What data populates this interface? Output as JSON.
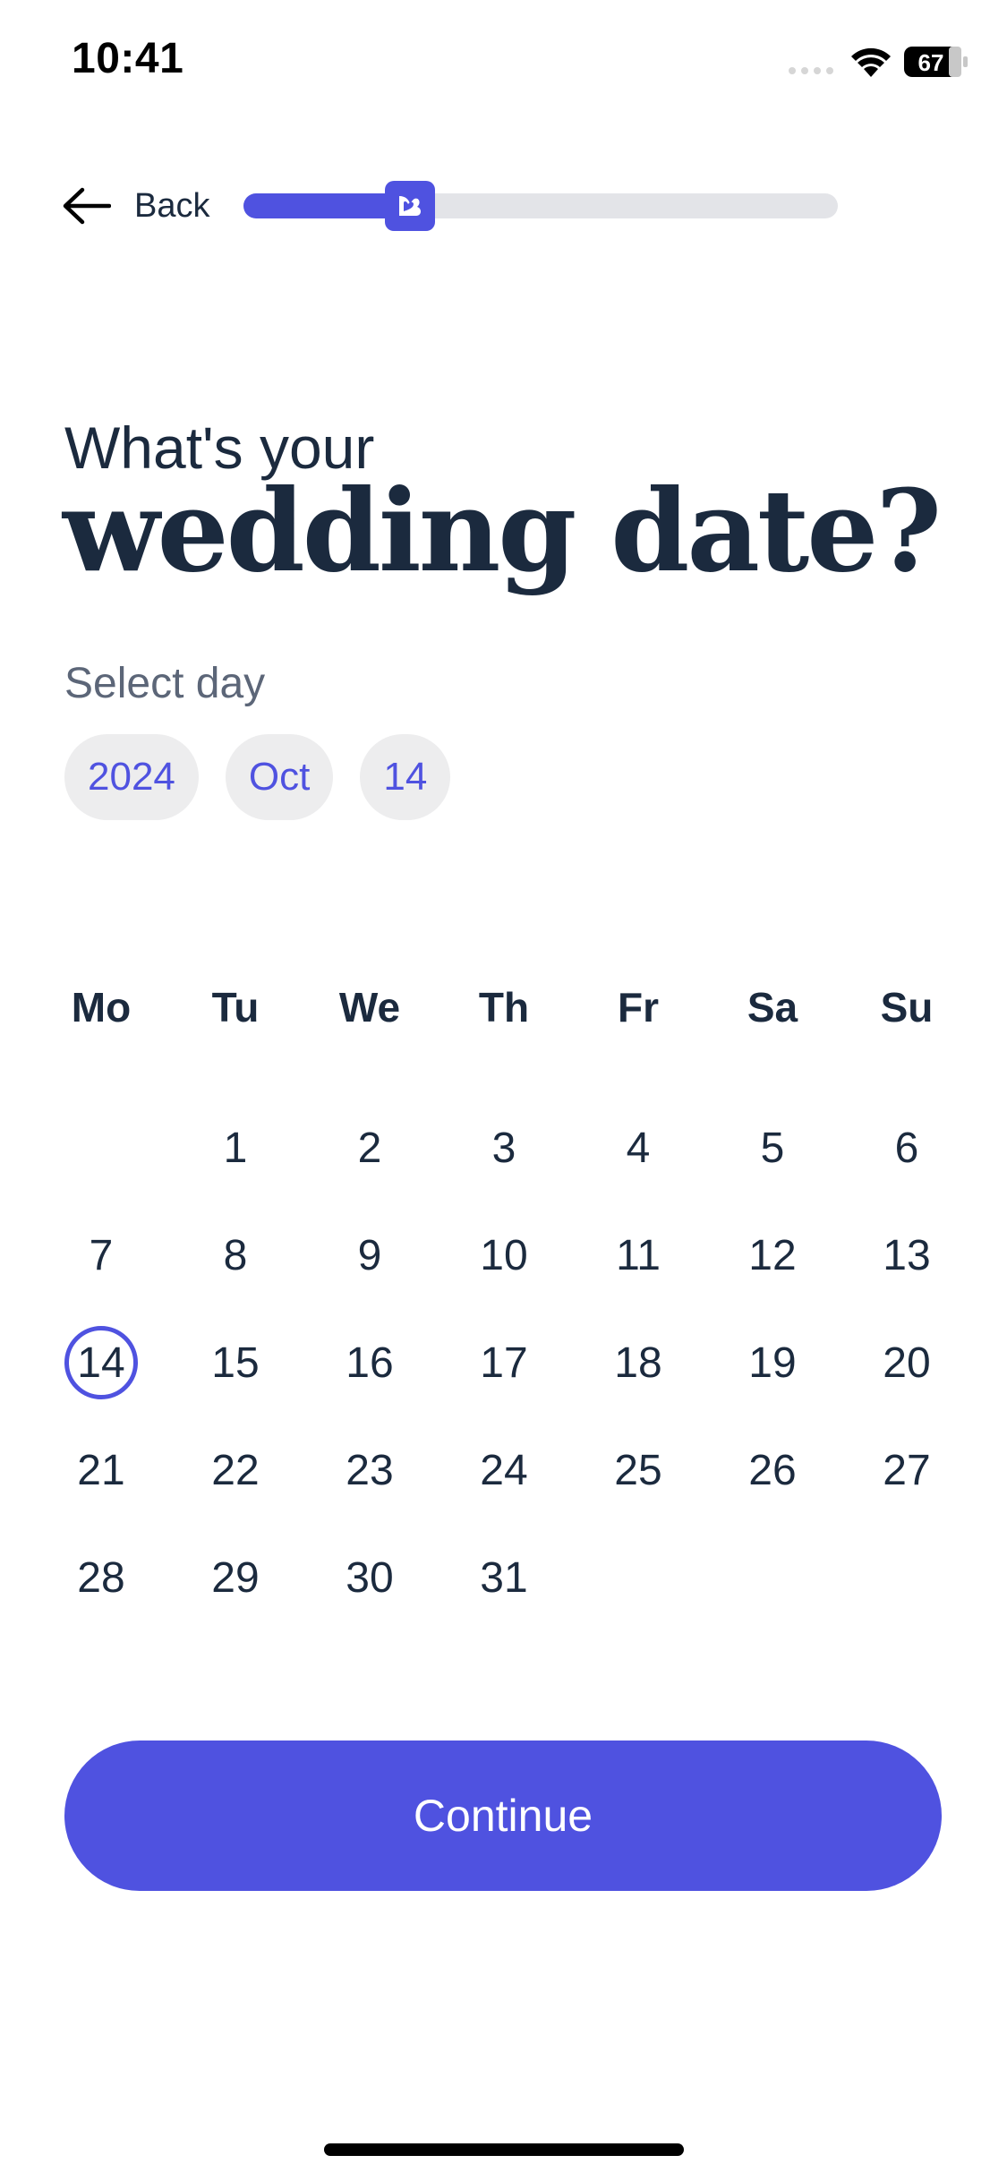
{
  "status_bar": {
    "time": "10:41",
    "battery": "67"
  },
  "header": {
    "back_label": "Back",
    "progress": 0.28
  },
  "heading": {
    "line1": "What's your",
    "line2": "wedding date?"
  },
  "select_label": "Select day",
  "chips": {
    "year": "2024",
    "month": "Oct",
    "day": "14"
  },
  "calendar": {
    "weekdays": [
      "Mo",
      "Tu",
      "We",
      "Th",
      "Fr",
      "Sa",
      "Su"
    ],
    "weeks": [
      [
        "",
        "1",
        "2",
        "3",
        "4",
        "5",
        "6"
      ],
      [
        "7",
        "8",
        "9",
        "10",
        "11",
        "12",
        "13"
      ],
      [
        "14",
        "15",
        "16",
        "17",
        "18",
        "19",
        "20"
      ],
      [
        "21",
        "22",
        "23",
        "24",
        "25",
        "26",
        "27"
      ],
      [
        "28",
        "29",
        "30",
        "31",
        "",
        "",
        ""
      ]
    ],
    "selected_day": "14"
  },
  "continue_label": "Continue",
  "colors": {
    "accent": "#4f52e0",
    "text": "#1b2a3e",
    "chip_bg": "#ededee",
    "track": "#e3e4e8"
  }
}
